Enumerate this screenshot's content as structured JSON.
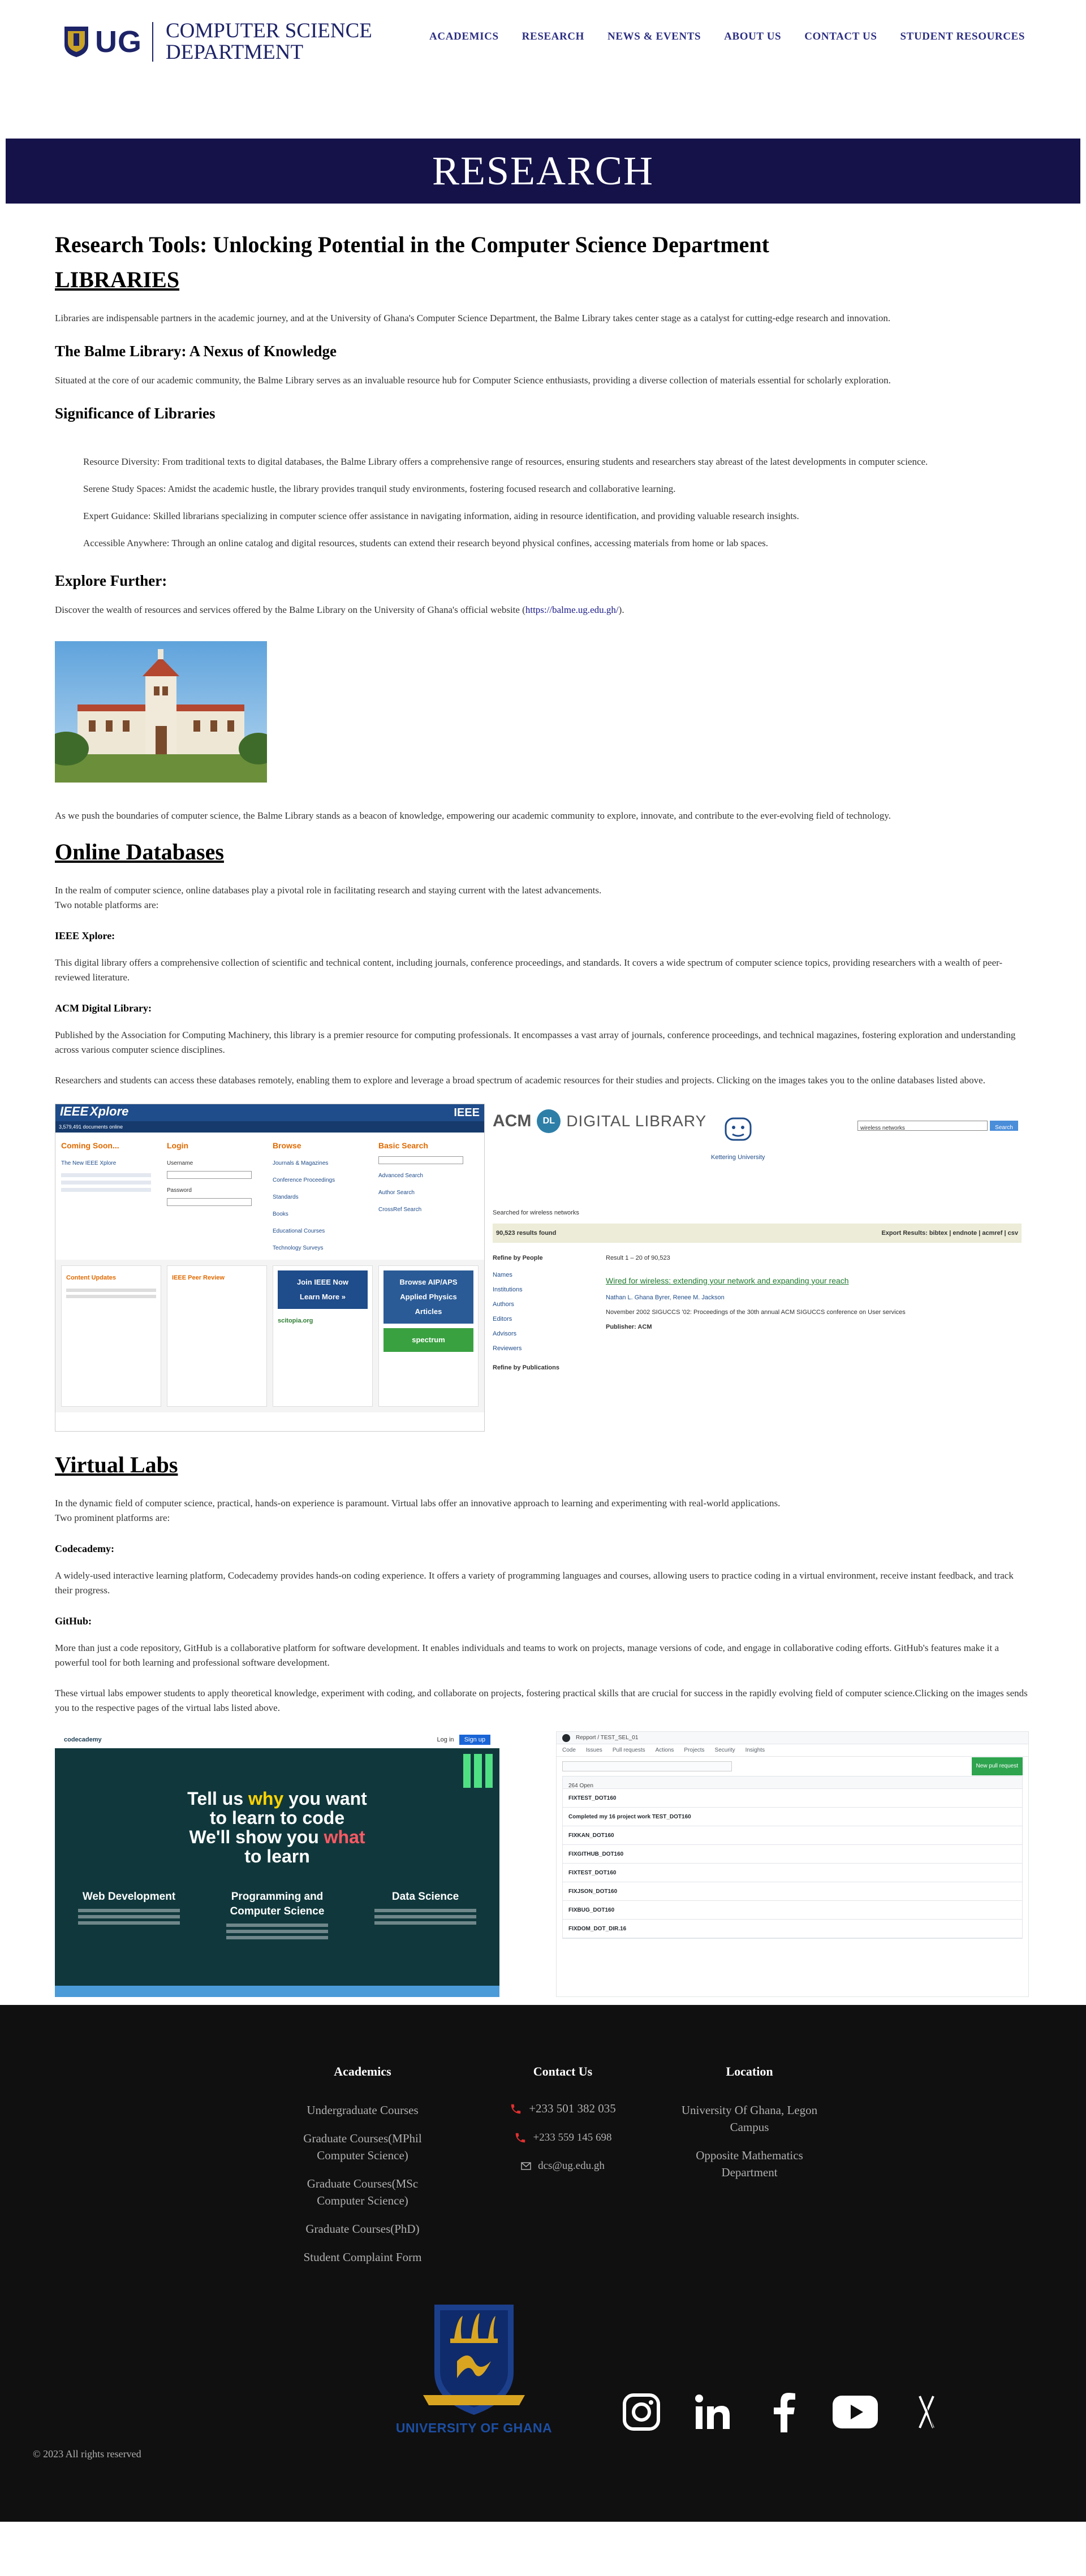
{
  "header": {
    "logo_short": "UG",
    "logo_line1": "COMPUTER SCIENCE",
    "logo_line2": "DEPARTMENT",
    "nav": [
      "ACADEMICS",
      "RESEARCH",
      "NEWS & EVENTS",
      "ABOUT US",
      "CONTACT US",
      "STUDENT RESOURCES"
    ]
  },
  "hero": {
    "title": "RESEARCH"
  },
  "content": {
    "main_title": "Research Tools: Unlocking Potential in the Computer Science Department",
    "libraries": {
      "heading": "LIBRARIES",
      "intro": "Libraries are indispensable partners in the academic journey, and at the University of Ghana's Computer Science Department, the Balme Library takes center stage as a catalyst for cutting-edge research and innovation.",
      "balme_heading": "The Balme Library: A Nexus of Knowledge",
      "balme_text": "Situated at the core of our academic community, the Balme Library serves as an invaluable resource hub for Computer Science enthusiasts, providing a diverse collection of materials essential for scholarly exploration.",
      "significance_heading": "Significance of Libraries",
      "significance": [
        "Resource Diversity: From traditional texts to digital databases, the Balme Library offers a comprehensive range of resources, ensuring students and researchers stay abreast of the latest developments in computer science.",
        "Serene Study Spaces: Amidst the academic hustle, the library provides tranquil study environments, fostering focused research and collaborative learning.",
        "Expert Guidance: Skilled librarians specializing in computer science offer assistance in navigating information, aiding in resource identification, and providing valuable research insights.",
        "Accessible Anywhere: Through an online catalog and digital resources, students can extend their research beyond physical confines, accessing materials from home or lab spaces."
      ],
      "explore_heading": "Explore Further:",
      "explore_text": "Discover the wealth of resources and services offered by the Balme Library on the University of Ghana's official website (",
      "explore_link": "https://balme.ug.edu.gh/",
      "explore_end": ").",
      "closing": "As we push the boundaries of computer science, the Balme Library stands as a beacon of knowledge, empowering our academic community to explore, innovate, and contribute to the ever-evolving field of technology."
    },
    "databases": {
      "heading": "Online Databases",
      "intro1": "In the realm of computer science, online databases play a pivotal role in facilitating research and staying current with the latest advancements.",
      "intro2": "Two notable platforms are:",
      "ieee_heading": "IEEE Xplore:",
      "ieee_text": "This digital library offers a comprehensive collection of scientific and technical content, including journals, conference proceedings, and standards. It covers a wide spectrum of computer science topics, providing researchers with a wealth of peer-reviewed literature.",
      "acm_heading": "ACM Digital Library:",
      "acm_text": "Published by the Association for Computing Machinery, this library is a premier resource for computing professionals. It encompasses a vast array of journals, conference proceedings, and technical magazines, fostering exploration and understanding across various computer science disciplines.",
      "closing": "Researchers and students can access these databases remotely, enabling them to explore and leverage a broad spectrum of academic resources for their studies and projects. Clicking on the images takes you to the online databases listed above."
    },
    "labs": {
      "heading": "Virtual Labs",
      "intro1": "In the dynamic field of computer science, practical, hands-on experience is paramount. Virtual labs offer an innovative approach to learning and experimenting with real-world applications.",
      "intro2": "Two prominent platforms are:",
      "codecademy_heading": "Codecademy:",
      "codecademy_text": "A widely-used interactive learning platform, Codecademy provides hands-on coding experience. It offers a variety of programming languages and courses, allowing users to practice coding in a virtual environment, receive instant feedback, and track their progress.",
      "github_heading": "GitHub:",
      "github_text": "More than just a code repository, GitHub is a collaborative platform for software development. It enables individuals and teams to work on projects, manage versions of code, and engage in collaborative coding efforts. GitHub's features make it a powerful tool for both learning and professional software development.",
      "closing": "These virtual labs empower students to apply theoretical knowledge, experiment with coding, and collaborate on projects, fostering practical skills that are crucial for success in the rapidly evolving field of computer science.Clicking on the images sends you to the respective pages of the virtual labs listed above."
    }
  },
  "ieee_shot": {
    "brand": "IEEE",
    "product": "Xplore",
    "docs": "3,579,491 documents online",
    "coming_soon": "Coming Soon...",
    "new_xplore": "The New IEEE Xplore",
    "login_heading": "Login",
    "username": "Username",
    "password": "Password",
    "browse_heading": "Browse",
    "browse_items": [
      "Journals & Magazines",
      "Conference Proceedings",
      "Standards",
      "Books",
      "Educational Courses",
      "Technology Surveys"
    ],
    "search_heading": "Basic Search",
    "search_links": [
      "Advanced Search",
      "Author Search",
      "CrossRef Search"
    ],
    "content_updates": "Content Updates",
    "peer_review": "IEEE Peer Review",
    "join_now": "Join IEEE Now",
    "learn_more": "Learn More »",
    "scitopia": "scitopia.org",
    "apis": "Browse AIP/APS Applied Physics Articles",
    "spectrum": "spectrum"
  },
  "acm_shot": {
    "acm": "ACM",
    "dl": "DL",
    "library": "DIGITAL LIBRARY",
    "kettering": "Kettering University",
    "search_value": "wireless networks",
    "search_button": "Search",
    "searched_for": "Searched for wireless networks",
    "results_found": "90,523 results found",
    "export": "Export Results: bibtex | endnote | acmref | csv",
    "refine_people": "Refine by People",
    "people_items": [
      "Names",
      "Institutions",
      "Authors",
      "Editors",
      "Advisors",
      "Reviewers"
    ],
    "refine_pubs": "Refine by Publications",
    "result_range": "Result 1 – 20 of 90,523",
    "result_title": "Wired for wireless: extending your network and expanding your reach",
    "result_authors": "Nathan L. Ghana Byrer, Renee M. Jackson",
    "result_source": "November 2002   SIGUCCS '02: Proceedings of the 30th annual ACM SIGUCCS conference on User services",
    "result_publisher": "Publisher: ACM"
  },
  "codecademy_shot": {
    "brand": "codecademy",
    "login": "Log in",
    "signup": "Sign up",
    "hero_l1a": "Tell us ",
    "hero_l1b": "why",
    "hero_l1c": " you want",
    "hero_l2": "to learn to code",
    "hero_l3a": "We'll show you ",
    "hero_l3b": "what",
    "hero_l4": "to learn",
    "cats": [
      "Web Development",
      "Programming and Computer Science",
      "Data Science"
    ]
  },
  "github_shot": {
    "path": "Repport / TEST_SEL_01",
    "tabs": [
      "Code",
      "Issues",
      "Pull requests",
      "Actions",
      "Projects",
      "Security",
      "Insights"
    ],
    "new_issue": "New pull request",
    "list_head": "264 Open",
    "rows": [
      "FIXTEST_DOT160",
      "Completed my 16 project work TEST_DOT160",
      "FIXKAN_DOT160",
      "FIXGITHUB_DOT160",
      "FIXTEST_DOT160",
      "FIXJSON_DOT160",
      "FIXBUG_DOT160",
      "FIXDOM_DOT_DIR.16"
    ]
  },
  "footer": {
    "academics_heading": "Academics",
    "academics": [
      "Undergraduate Courses",
      "Graduate Courses(MPhil Computer Science)",
      "Graduate Courses(MSc Computer Science)",
      "Graduate Courses(PhD)",
      "Student Complaint Form"
    ],
    "contact_heading": "Contact Us",
    "phone1": "+233 501 382 035",
    "phone2": "+233 559 145 698",
    "email": "dcs@ug.edu.gh",
    "location_heading": "Location",
    "location1": "University Of Ghana, Legon Campus",
    "location2": "Opposite Mathematics Department",
    "crest_caption": "UNIVERSITY OF GHANA",
    "copyright": "© 2023 All rights reserved"
  },
  "colors": {
    "navy": "#15124a",
    "nav_text": "#2b2e83",
    "footer_bg": "#101010",
    "phone_red": "#e03030"
  }
}
